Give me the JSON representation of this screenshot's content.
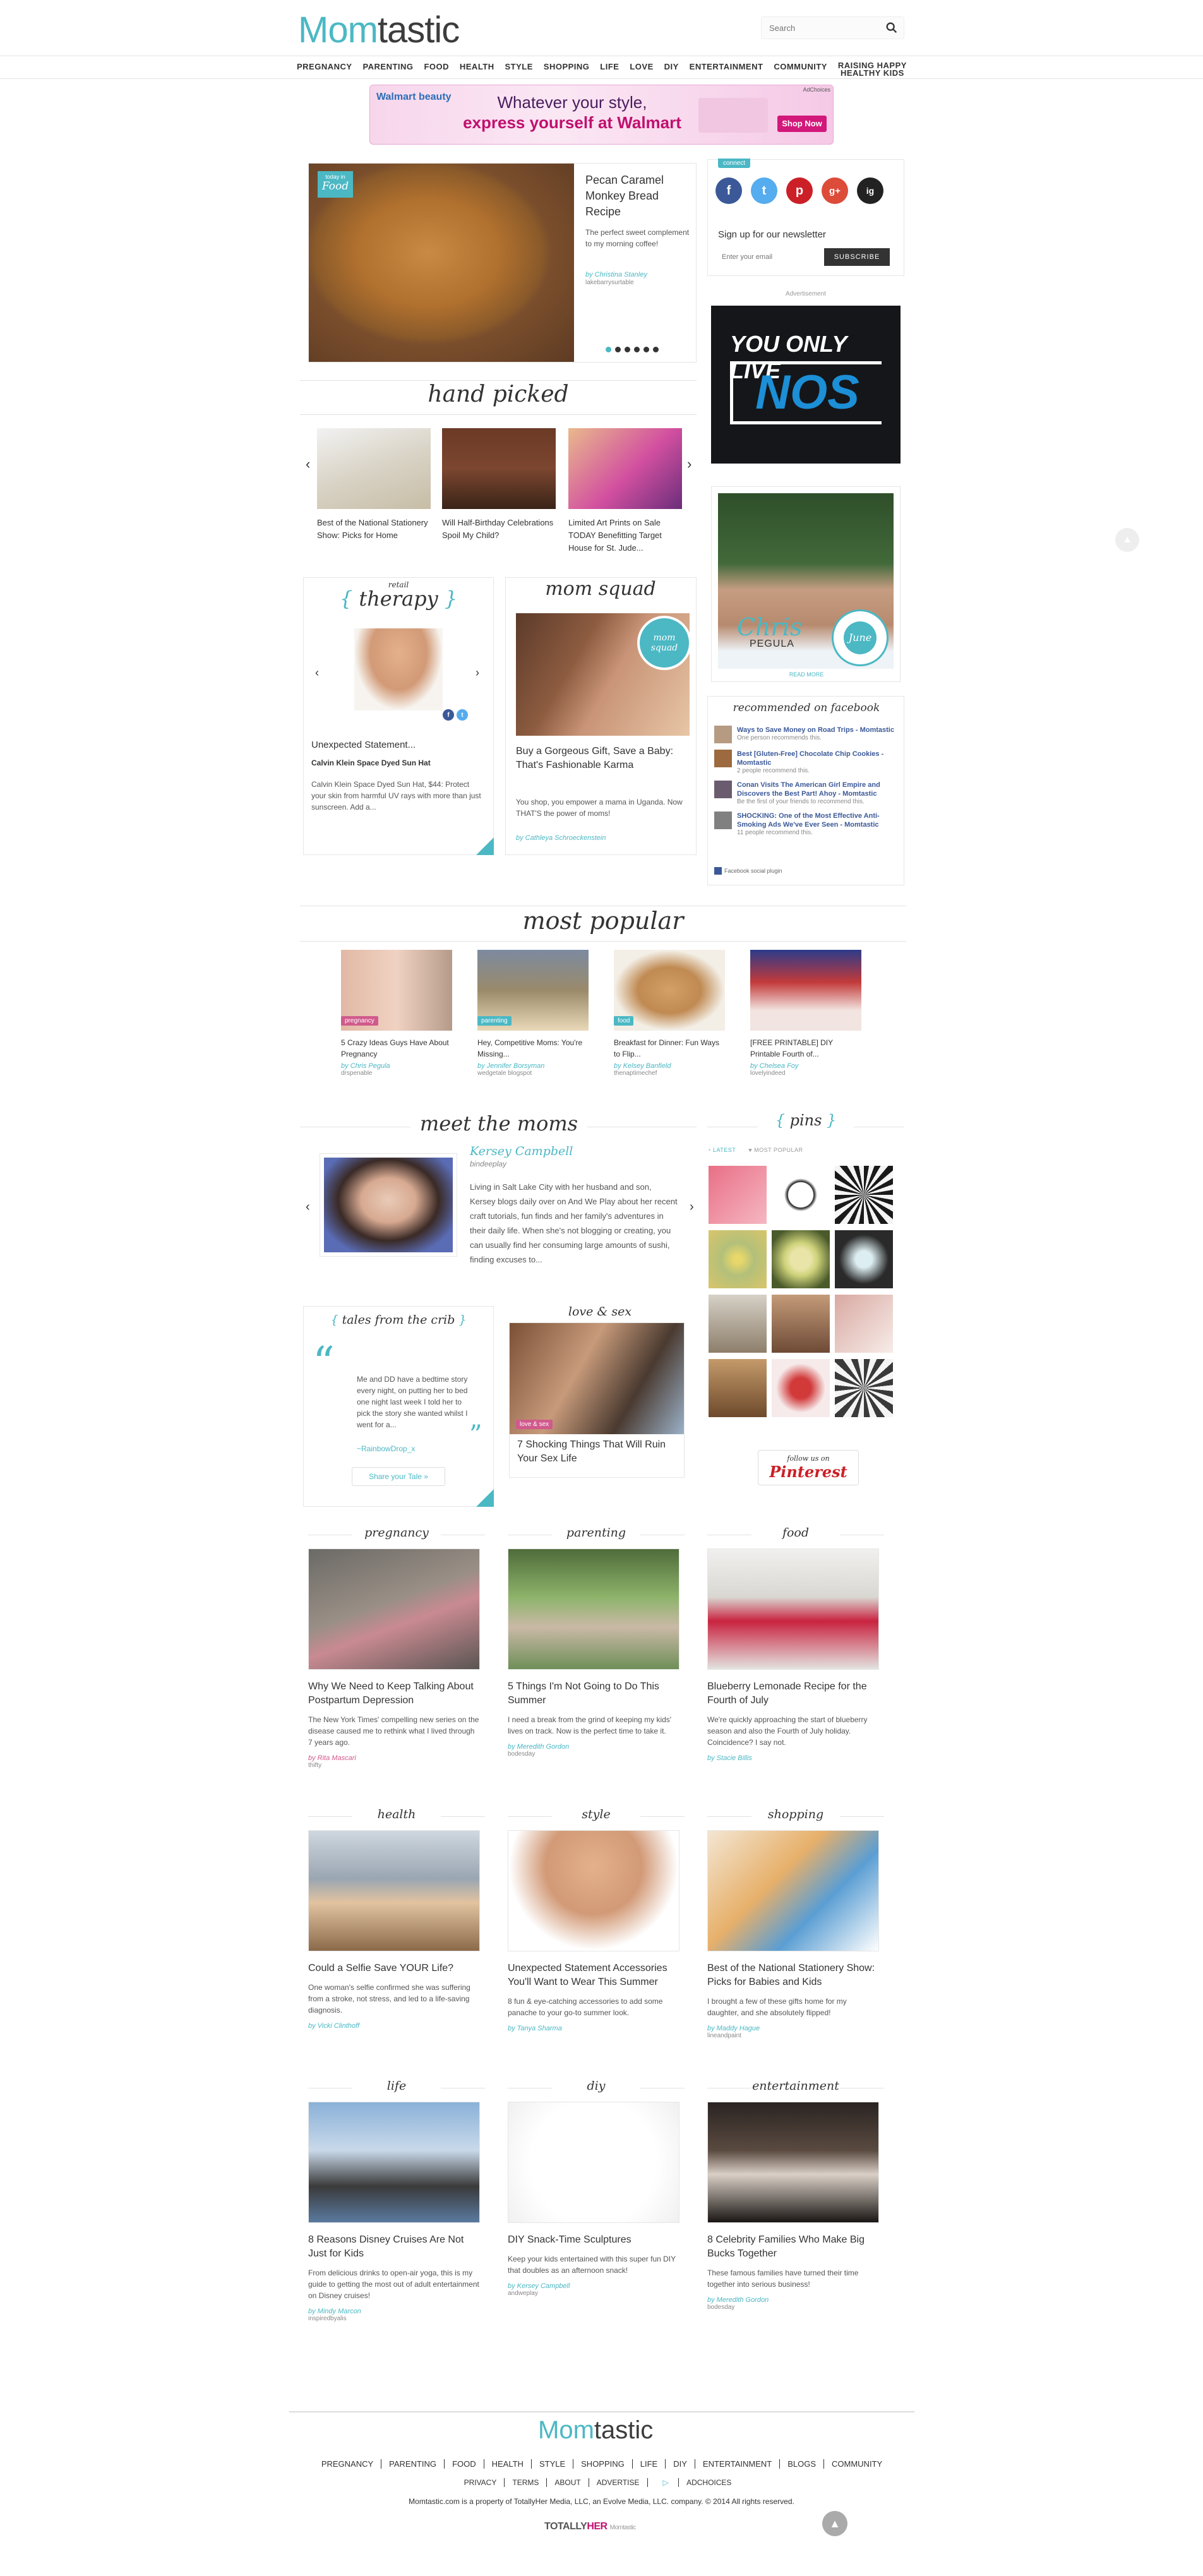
{
  "header": {
    "logo_m": "Mom",
    "logo_t": "tastic",
    "search_placeholder": "Search",
    "nav": [
      "PREGNANCY",
      "PARENTING",
      "FOOD",
      "HEALTH",
      "STYLE",
      "SHOPPING",
      "LIFE",
      "LOVE",
      "DIY",
      "ENTERTAINMENT",
      "COMMUNITY"
    ],
    "nav_last_1": "RAISING HAPPY",
    "nav_last_2": "HEALTHY KIDS"
  },
  "ad_top": {
    "brand": "Walmart beauty",
    "line1": "Whatever your style,",
    "line2": "express yourself at Walmart",
    "cta": "Shop Now",
    "adchoices": "AdChoices"
  },
  "hero": {
    "badge_small": "today in",
    "badge_big": "Food",
    "title": "Pecan Caramel Monkey Bread Recipe",
    "desc": "The perfect sweet complement to my morning coffee!",
    "by": "by Christina Stanley",
    "src": "lakebarrysurtable"
  },
  "connect": {
    "label": "connect",
    "newsletter": "Sign up for our newsletter",
    "email_placeholder": "Enter your email",
    "subscribe": "SUBSCRIBE",
    "socials": [
      "f",
      "t",
      "p",
      "g+",
      "ig"
    ]
  },
  "advert_label": "Advertisement",
  "nos_ad": {
    "line1": "YOU ONLY LIVE",
    "line2": "NOS"
  },
  "june": {
    "first": "Chris",
    "last": "PEGULA",
    "badge": "June",
    "read_more": "READ MORE"
  },
  "facebook": {
    "title": "recommended on facebook",
    "items": [
      {
        "title": "Ways to Save Money on Road Trips - Momtastic",
        "count": "One person recommends this."
      },
      {
        "title": "Best [Gluten-Free] Chocolate Chip Cookies - Momtastic",
        "count": "2 people recommend this."
      },
      {
        "title": "Conan Visits The American Girl Empire and Discovers the Best Part! Ahoy - Momtastic",
        "count": "Be the first of your friends to recommend this."
      },
      {
        "title": "SHOCKING: One of the Most Effective Anti-Smoking Ads We've Ever Seen - Momtastic",
        "count": "11 people recommend this."
      }
    ],
    "plugin": "Facebook social plugin"
  },
  "hand_picked": {
    "title": "hand picked",
    "items": [
      {
        "caption": "Best of the National Stationery Show: Picks for Home"
      },
      {
        "caption": "Will Half-Birthday Celebrations Spoil My Child?"
      },
      {
        "caption": "Limited Art Prints on Sale TODAY Benefitting Target House for St. Jude..."
      }
    ]
  },
  "retail": {
    "small": "retail",
    "title": "therapy",
    "caption": "Unexpected Statement...",
    "product": "Calvin Klein Space Dyed Sun Hat",
    "desc": "Calvin Klein Space Dyed Sun Hat, $44: Protect your skin from harmful UV rays with more than just sunscreen. Add a..."
  },
  "mom_squad": {
    "title": "mom squad",
    "badge": "mom squad",
    "headline": "Buy a Gorgeous Gift, Save a Baby: That's Fashionable Karma",
    "desc": "You shop, you empower a mama in Uganda. Now THAT'S the power of moms!",
    "by": "by Cathleya Schroeckenstein"
  },
  "most_popular": {
    "title": "most popular",
    "items": [
      {
        "tag": "pregnancy",
        "tag_color": "#d05a8c",
        "caption": "5 Crazy Ideas Guys Have About Pregnancy",
        "by": "by Chris Pegula",
        "src": "drspenable"
      },
      {
        "tag": "parenting",
        "tag_color": "#4bb8c4",
        "caption": "Hey, Competitive Moms: You're Missing...",
        "by": "by Jennifer Borsyman",
        "src": "wedgetale blogspot"
      },
      {
        "tag": "food",
        "tag_color": "#4bb8c4",
        "caption": "Breakfast for Dinner: Fun Ways to Flip...",
        "by": "by Kelsey Banfield",
        "src": "thenaptimechef"
      },
      {
        "tag": "",
        "tag_color": "#4bb8c4",
        "caption": "[FREE PRINTABLE] DIY Printable Fourth of...",
        "by": "by Chelsea Foy",
        "src": "lovelyindeed"
      }
    ]
  },
  "meet_moms": {
    "title": "meet the moms",
    "name": "Kersey Campbell",
    "src": "bindeeplay",
    "bio": "Living in Salt Lake City with her husband and son, Kersey blogs daily over on And We Play about her recent craft tutorials, fun finds and her family's adventures in their daily life. When she's not blogging or creating, you can usually find her consuming large amounts of sushi, finding excuses to..."
  },
  "pins": {
    "title": "pins",
    "latest": "LATEST",
    "popular": "MOST POPULAR",
    "follow1": "follow us on",
    "follow2": "Pinterest"
  },
  "tales": {
    "title": "tales from the crib",
    "quote": "Me and DD have a bedtime story every night, on putting her to bed one night last week I told her to pick the story she wanted whilst I went for a...",
    "author": "~RainbowDrop_x",
    "share": "Share your Tale »"
  },
  "love_sex": {
    "title": "love & sex",
    "tag": "love & sex",
    "headline": "7 Shocking Things That Will Ruin Your Sex Life"
  },
  "categories": [
    {
      "name": "pregnancy",
      "headline": "Why We Need to Keep Talking About Postpartum Depression",
      "desc": "The New York Times' compelling new series on the disease caused me to rethink what I lived through 7 years ago.",
      "by": "by Rita Mascari",
      "src": "thifty",
      "color": "#d05a8c"
    },
    {
      "name": "parenting",
      "headline": "5 Things I'm Not Going to Do This Summer",
      "desc": "I need a break from the grind of keeping my kids' lives on track. Now is the perfect time to take it.",
      "by": "by Meredith Gordon",
      "src": "bodesday",
      "color": "#4bb8c4"
    },
    {
      "name": "food",
      "headline": "Blueberry Lemonade Recipe for the Fourth of July",
      "desc": "We're quickly approaching the start of blueberry season and also the Fourth of July holiday. Coincidence? I say not.",
      "by": "by Stacie Billis",
      "src": "",
      "color": "#4bb8c4"
    },
    {
      "name": "health",
      "headline": "Could a Selfie Save YOUR Life?",
      "desc": "One woman's selfie confirmed she was suffering from a stroke, not stress, and led to a life-saving diagnosis.",
      "by": "by Vicki Clinthoff",
      "src": "",
      "color": "#4bb8c4"
    },
    {
      "name": "style",
      "headline": "Unexpected Statement Accessories You'll Want to Wear This Summer",
      "desc": "8 fun & eye-catching accessories to add some panache to your go-to summer look.",
      "by": "by Tanya Sharma",
      "src": "",
      "color": "#4bb8c4"
    },
    {
      "name": "shopping",
      "headline": "Best of the National Stationery Show: Picks for Babies and Kids",
      "desc": "I brought a few of these gifts home for my daughter, and she absolutely flipped!",
      "by": "by Maddy Hague",
      "src": "lineandpaint",
      "color": "#4bb8c4"
    },
    {
      "name": "life",
      "headline": "8 Reasons Disney Cruises Are Not Just for Kids",
      "desc": "From delicious drinks to open-air yoga, this is my guide to getting the most out of adult entertainment on Disney cruises!",
      "by": "by Mindy Marcon",
      "src": "inspiredbyalis",
      "color": "#4bb8c4"
    },
    {
      "name": "diy",
      "headline": "DIY Snack-Time Sculptures",
      "desc": "Keep your kids entertained with this super fun DIY that doubles as an afternoon snack!",
      "by": "by Kersey Campbell",
      "src": "andweplay",
      "color": "#4bb8c4"
    },
    {
      "name": "entertainment",
      "headline": "8 Celebrity Families Who Make Big Bucks Together",
      "desc": "These famous families have turned their time together into serious business!",
      "by": "by Meredith Gordon",
      "src": "bodesday",
      "color": "#4bb8c4"
    }
  ],
  "footer": {
    "logo_m": "Mom",
    "logo_t": "tastic",
    "nav": [
      "PREGNANCY",
      "PARENTING",
      "FOOD",
      "HEALTH",
      "STYLE",
      "SHOPPING",
      "LIFE",
      "DIY",
      "ENTERTAINMENT",
      "BLOGS",
      "COMMUNITY"
    ],
    "nav2": [
      "PRIVACY",
      "TERMS",
      "ABOUT",
      "ADVERTISE",
      "ADCHOICES"
    ],
    "legal": "Momtastic.com is a property of TotallyHer Media, LLC, an Evolve Media, LLC. company. © 2014 All rights reserved.",
    "brand1": "TOTALLY",
    "brand2": "HER",
    "brand3": "Momtastic"
  },
  "colors": {
    "accent": "#4bb8c4",
    "pink": "#d05a8c"
  }
}
